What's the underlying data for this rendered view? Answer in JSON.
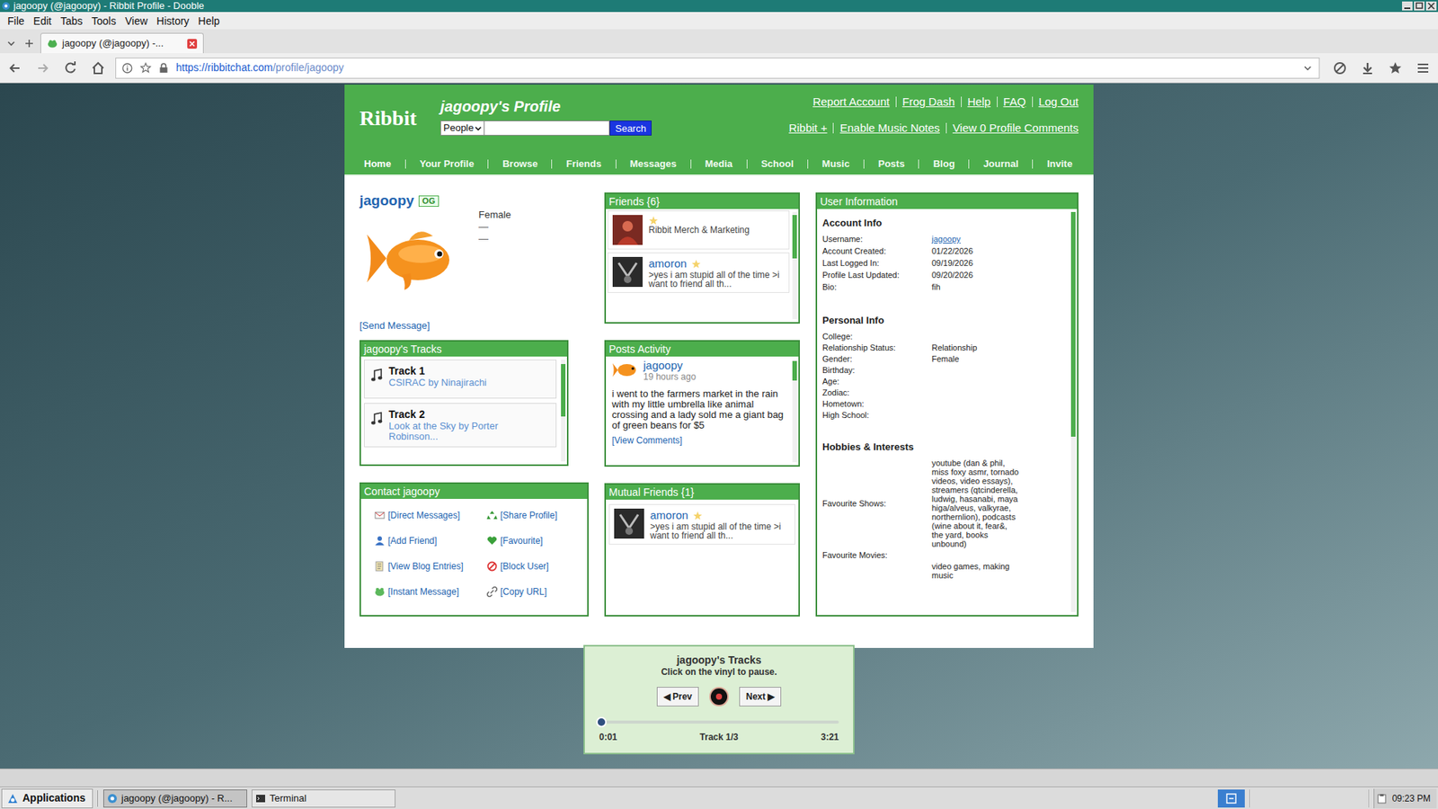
{
  "window": {
    "title": "jagoopy (@jagoopy) - Ribbit Profile - Dooble"
  },
  "menu": [
    "File",
    "Edit",
    "Tabs",
    "Tools",
    "View",
    "History",
    "Help"
  ],
  "tabs": [
    {
      "label": "jagoopy (@jagoopy) -...",
      "selected": true
    }
  ],
  "address": {
    "host": "https://ribbitchat.com",
    "path": "/profile/jagoopy"
  },
  "site": {
    "logo": "Ribbit",
    "title": "jagoopy's Profile",
    "search": {
      "category": "People",
      "button": "Search"
    },
    "top_links": [
      "Report Account",
      "Frog Dash",
      "Help",
      "FAQ",
      "Log Out"
    ],
    "sub_links": [
      "Ribbit +",
      "Enable Music Notes",
      "View 0 Profile Comments"
    ],
    "nav": [
      {
        "label": "Home",
        "selected": true
      },
      {
        "label": "Your Profile",
        "selected": false
      },
      {
        "label": "Browse",
        "selected": false
      },
      {
        "label": "Friends",
        "selected": false
      },
      {
        "label": "Messages",
        "selected": false
      },
      {
        "label": "Media",
        "selected": false
      },
      {
        "label": "School",
        "selected": false
      },
      {
        "label": "Music",
        "selected": false
      },
      {
        "label": "Posts",
        "selected": false
      },
      {
        "label": "Blog",
        "selected": false
      },
      {
        "label": "Journal",
        "selected": false
      },
      {
        "label": "Invite",
        "selected": false
      }
    ]
  },
  "profile": {
    "name": "jagoopy",
    "badge": "OG",
    "gender": "Female",
    "details": [
      "—",
      "—"
    ],
    "send_message": "[Send Message]"
  },
  "tracks": {
    "title": "jagoopy's Tracks",
    "items": [
      {
        "label": "Track 1",
        "song": "CSIRAC by Ninajirachi"
      },
      {
        "label": "Track 2",
        "song": "Look at the Sky by Porter Robinson..."
      }
    ]
  },
  "contact": {
    "title": "Contact jagoopy",
    "links": [
      "[Direct Messages]",
      "[Share Profile]",
      "[Add Friend]",
      "[Favourite]",
      "[View Blog Entries]",
      "[Block User]",
      "[Instant Message]",
      "[Copy URL]"
    ]
  },
  "friends": {
    "title": "Friends {6}",
    "items": [
      {
        "name": "",
        "starred": true,
        "text": "Ribbit Merch & Marketing"
      },
      {
        "name": "amoron",
        "starred": true,
        "text": ">yes i am stupid all of the time >i want to friend all th..."
      }
    ]
  },
  "posts": {
    "title": "Posts Activity",
    "items": [
      {
        "author": "jagoopy",
        "time": "19 hours ago",
        "body": "i went to the farmers market in the rain with my little umbrella like animal crossing and a lady sold me a giant bag of green beans for $5",
        "link": "[View Comments]"
      }
    ]
  },
  "mutual": {
    "title": "Mutual Friends {1}",
    "items": [
      {
        "name": "amoron",
        "starred": true,
        "text": ">yes i am stupid all of the time >i want to friend all th..."
      }
    ]
  },
  "user_info": {
    "title": "User Information",
    "sections": [
      {
        "title": "Account Info",
        "rows": [
          {
            "label": "Username:",
            "value": "jagoopy",
            "link": true
          },
          {
            "label": "Account Created:",
            "value": "01/22/2026",
            "link": false
          },
          {
            "label": "Last Logged In:",
            "value": "09/19/2026",
            "link": false
          },
          {
            "label": "Profile Last Updated:",
            "value": "09/20/2026",
            "link": false
          },
          {
            "label": "Bio:",
            "value": "fih",
            "link": false
          }
        ]
      },
      {
        "title": "Personal Info",
        "rows": [
          {
            "label": "College:",
            "value": "",
            "link": false
          },
          {
            "label": "Relationship Status:",
            "value": "Relationship",
            "link": false
          },
          {
            "label": "Gender:",
            "value": "Female",
            "link": false
          },
          {
            "label": "Birthday:",
            "value": "",
            "link": false
          },
          {
            "label": "Age:",
            "value": "",
            "link": false
          },
          {
            "label": "Zodiac:",
            "value": "",
            "link": false
          },
          {
            "label": "Hometown:",
            "value": "",
            "link": false
          },
          {
            "label": "High School:",
            "value": "",
            "link": false
          }
        ]
      },
      {
        "title": "Hobbies & Interests",
        "rows": [
          {
            "label": "Favourite Shows:",
            "value": "youtube (dan & phil, miss foxy asmr, tornado videos, video essays), streamers (qtcinderella, ludwig, hasanabi, maya higa/alveus, valkyrae, northernlion), podcasts (wine about it, fear&, the yard, books unbound)",
            "link": false
          },
          {
            "label": "Favourite Movies:",
            "value": "",
            "link": false
          },
          {
            "label": "",
            "value": "video games, making music",
            "link": false
          }
        ]
      }
    ]
  },
  "player": {
    "title": "jagoopy's Tracks",
    "hint": "Click on the vinyl to pause.",
    "prev": "◀ Prev",
    "next": "Next ▶",
    "playing": true,
    "level": 0.01,
    "elapsed": "0:01",
    "track": "Track 1/3",
    "duration": "3:21"
  },
  "taskbar": {
    "start": "Applications",
    "windows": [
      {
        "label": "jagoopy (@jagoopy) - R...",
        "selected": true
      },
      {
        "label": "Terminal",
        "selected": false
      }
    ],
    "clock": "09:23 PM"
  }
}
